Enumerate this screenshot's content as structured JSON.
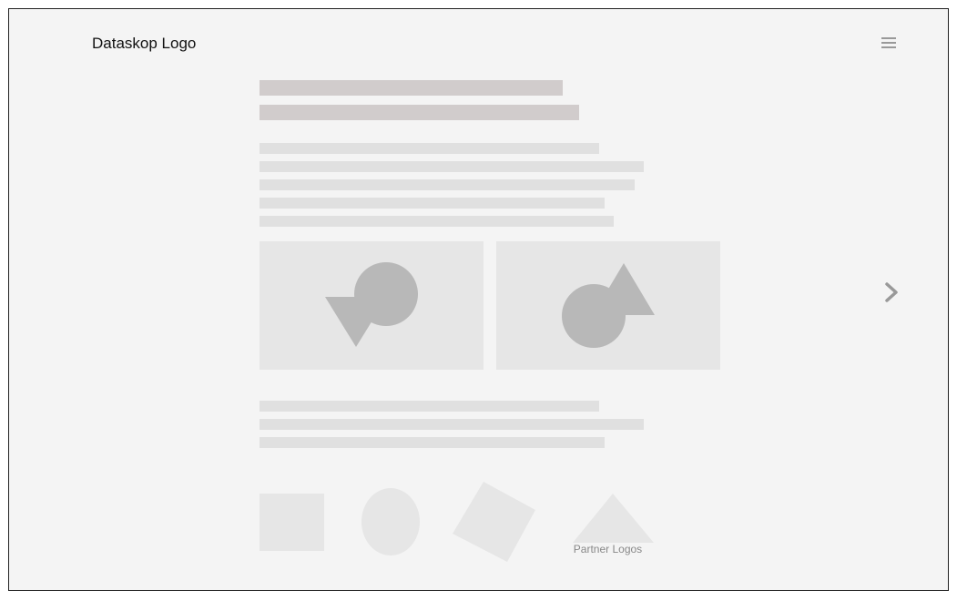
{
  "header": {
    "logo_text": "Dataskop Logo",
    "menu_icon": "hamburger-menu-icon"
  },
  "navigation": {
    "next_icon": "chevron-right-icon"
  },
  "content": {
    "heading_lines": 2,
    "intro_lines": 5,
    "image_panels": [
      "abstract-shapes-image-1",
      "abstract-shapes-image-2"
    ],
    "body_lines": 3
  },
  "partners": {
    "label": "Partner Logos",
    "logos": [
      "square-logo",
      "ellipse-logo",
      "diamond-logo",
      "triangle-logo"
    ]
  },
  "colors": {
    "background": "#f4f4f4",
    "heading_placeholder": "#d1cccc",
    "text_placeholder": "#e0e0e0",
    "panel": "#e6e6e6",
    "shape": "#b8b8b8",
    "partner_shape": "#e6e6e6"
  }
}
